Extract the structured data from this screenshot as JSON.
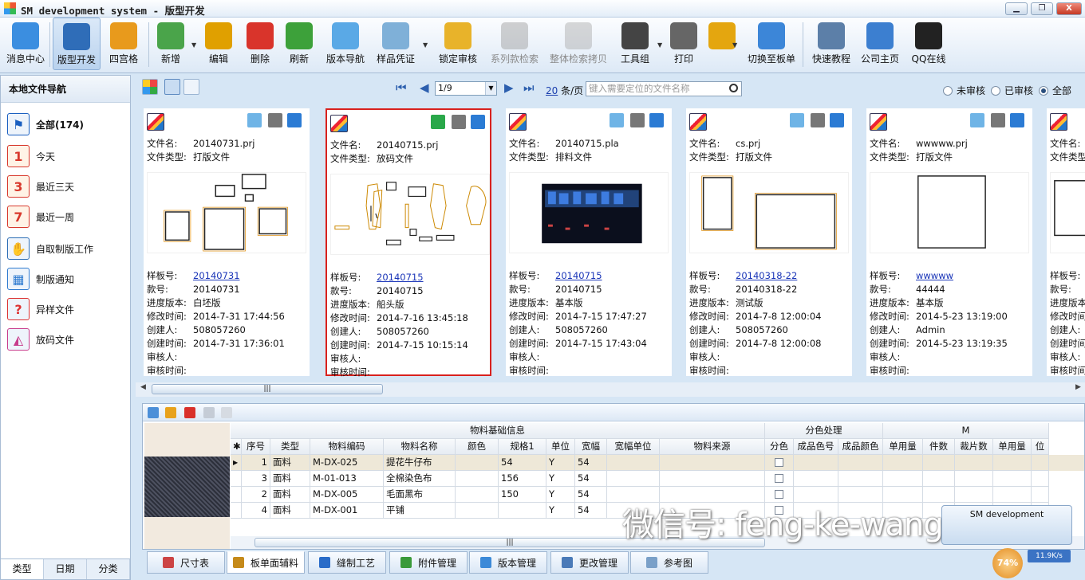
{
  "window": {
    "title": "SM development system - 版型开发",
    "minimize": "▁",
    "maximize": "❐",
    "close": "X"
  },
  "toolbar": [
    {
      "label": "消息中心",
      "icon": "chat-bubble-icon",
      "color": "#3b8ee0"
    },
    {
      "label": "版型开发",
      "icon": "cad-icon",
      "color": "#2f6db8"
    },
    {
      "label": "四宫格",
      "icon": "four-grid-icon",
      "color": "#e89a1c"
    },
    {
      "label": "新增",
      "icon": "new-doc-icon",
      "color": "#4aa44a"
    },
    {
      "label": "编辑",
      "icon": "edit-doc-icon",
      "color": "#e0a000"
    },
    {
      "label": "删除",
      "icon": "delete-doc-icon",
      "color": "#d9342b"
    },
    {
      "label": "刷新",
      "icon": "refresh-icon",
      "color": "#3da13a"
    },
    {
      "label": "版本导航",
      "icon": "version-nav-icon",
      "color": "#5aa9e6"
    },
    {
      "label": "样品凭证",
      "icon": "shirt-icon",
      "color": "#7fb0d8"
    },
    {
      "label": "锁定审核",
      "icon": "lock-icon",
      "color": "#e8b32a"
    },
    {
      "label": "系列款检索",
      "icon": "series-search-icon",
      "color": "#9a9a9a"
    },
    {
      "label": "整体检索拷贝",
      "icon": "copy-search-icon",
      "color": "#a8a8a8"
    },
    {
      "label": "工具组",
      "icon": "toolbox-icon",
      "color": "#444"
    },
    {
      "label": "打印",
      "icon": "printer-icon",
      "color": "#666"
    },
    {
      "label": "",
      "icon": "gear-icon",
      "color": "#e4a60f"
    },
    {
      "label": "切换至板单",
      "icon": "switch-icon",
      "color": "#3c86d8"
    },
    {
      "label": "快速教程",
      "icon": "tutorial-icon",
      "color": "#5c7fa8"
    },
    {
      "label": "公司主页",
      "icon": "thumbs-up-icon",
      "color": "#3c7fd0"
    },
    {
      "label": "QQ在线",
      "icon": "qq-penguin-icon",
      "color": "#222"
    }
  ],
  "nav": {
    "title": "本地文件导航",
    "items": [
      {
        "label": "全部(174)",
        "icon": "flag-icon",
        "color": "#1a5fc0",
        "glyph": "⚑"
      },
      {
        "label": "今天",
        "icon": "calendar-1-icon",
        "color": "#d8382c",
        "glyph": "1"
      },
      {
        "label": "最近三天",
        "icon": "calendar-3-icon",
        "color": "#d8382c",
        "glyph": "3"
      },
      {
        "label": "最近一周",
        "icon": "calendar-7-icon",
        "color": "#d8382c",
        "glyph": "7"
      },
      {
        "label": "自取制版工作",
        "icon": "cad-hand-icon",
        "color": "#2c6db5",
        "glyph": "✋"
      },
      {
        "label": "制版通知",
        "icon": "grid-notice-icon",
        "color": "#2f7bd0",
        "glyph": "▦"
      },
      {
        "label": "异样文件",
        "icon": "question-shirt-icon",
        "color": "#d33",
        "glyph": "?"
      },
      {
        "label": "放码文件",
        "icon": "grading-icon",
        "color": "#c83c8c",
        "glyph": "◭"
      }
    ],
    "tabs": [
      "类型",
      "日期",
      "分类"
    ]
  },
  "pager": {
    "page": "1/9",
    "per_page_num": "20",
    "per_page_unit": "条/页",
    "search_placeholder": "键入需要定位的文件名称"
  },
  "filter": {
    "options": [
      "未审核",
      "已审核",
      "全部"
    ],
    "selected": "全部"
  },
  "field_labels": {
    "filename": "文件名:",
    "filetype": "文件类型:",
    "sample_no": "样板号:",
    "style_no": "款号:",
    "progress": "进度版本:",
    "modified": "修改时间:",
    "creator": "创建人:",
    "created": "创建时间:",
    "reviewer": "审核人:",
    "review_time": "审核时间:"
  },
  "cards": [
    {
      "filename": "20140731.prj",
      "filetype": "打版文件",
      "sample_no": "20140731",
      "style_no": "20140731",
      "progress": "白坯版",
      "modified": "2014-7-31 17:44:56",
      "creator": "508057260",
      "created": "2014-7-31 17:36:01",
      "reviewer": "",
      "review_time": ""
    },
    {
      "filename": "20140715.prj",
      "filetype": "放码文件",
      "sample_no": "20140715",
      "style_no": "20140715",
      "progress": "船头版",
      "modified": "2014-7-16 13:45:18",
      "creator": "508057260",
      "created": "2014-7-15 10:15:14",
      "reviewer": "",
      "review_time": ""
    },
    {
      "filename": "20140715.pla",
      "filetype": "排料文件",
      "sample_no": "20140715",
      "style_no": "20140715",
      "progress": "基本版",
      "modified": "2014-7-15 17:47:27",
      "creator": "508057260",
      "created": "2014-7-15 17:43:04",
      "reviewer": "",
      "review_time": ""
    },
    {
      "filename": "cs.prj",
      "filetype": "打版文件",
      "sample_no": "20140318-22",
      "style_no": "20140318-22",
      "progress": "测试版",
      "modified": "2014-7-8 12:00:04",
      "creator": "508057260",
      "created": "2014-7-8 12:00:08",
      "reviewer": "",
      "review_time": ""
    },
    {
      "filename": "wwwww.prj",
      "filetype": "打版文件",
      "sample_no": "wwwww",
      "style_no": "44444",
      "progress": "基本版",
      "modified": "2014-5-23 13:19:00",
      "creator": "Admin",
      "created": "2014-5-23 13:19:35",
      "reviewer": "",
      "review_time": ""
    },
    {
      "filename": "",
      "filetype": "",
      "sample_no": "",
      "style_no": "",
      "progress": "",
      "modified": "",
      "creator": "",
      "created": "",
      "reviewer": "",
      "review_time": ""
    }
  ],
  "grid": {
    "group_headers": [
      "物料基础信息",
      "分色处理",
      "M"
    ],
    "columns": [
      "",
      "序号",
      "类型",
      "物料编码",
      "物料名称",
      "颜色",
      "规格1",
      "单位",
      "宽幅",
      "宽幅单位",
      "物料来源",
      "分色",
      "成品色号",
      "成品颜色",
      "单用量",
      "件数",
      "裁片数",
      "单用量",
      "位"
    ],
    "rows": [
      {
        "marker": "▶",
        "no": "1",
        "type": "面料",
        "code": "M-DX-025",
        "name": "提花牛仔布",
        "color": "",
        "spec": "54",
        "unit": "Y",
        "width": "54"
      },
      {
        "marker": "",
        "no": "3",
        "type": "面料",
        "code": "M-01-013",
        "name": "全棉染色布",
        "color": "",
        "spec": "156",
        "unit": "Y",
        "width": "54"
      },
      {
        "marker": "",
        "no": "2",
        "type": "面料",
        "code": "M-DX-005",
        "name": "毛面黑布",
        "color": "",
        "spec": "150",
        "unit": "Y",
        "width": "54"
      },
      {
        "marker": "",
        "no": "4",
        "type": "面料",
        "code": "M-DX-001",
        "name": "平铺",
        "color": "",
        "spec": "",
        "unit": "Y",
        "width": "54"
      }
    ]
  },
  "bottom_tabs": [
    "尺寸表",
    "板单面辅料",
    "缝制工艺",
    "附件管理",
    "版本管理",
    "更改管理",
    "参考图"
  ],
  "overlay": {
    "watermark": "微信号: feng-ke-wang",
    "sm_box": "SM development",
    "gauge": "74%",
    "net_speed": "11.9K/s"
  }
}
